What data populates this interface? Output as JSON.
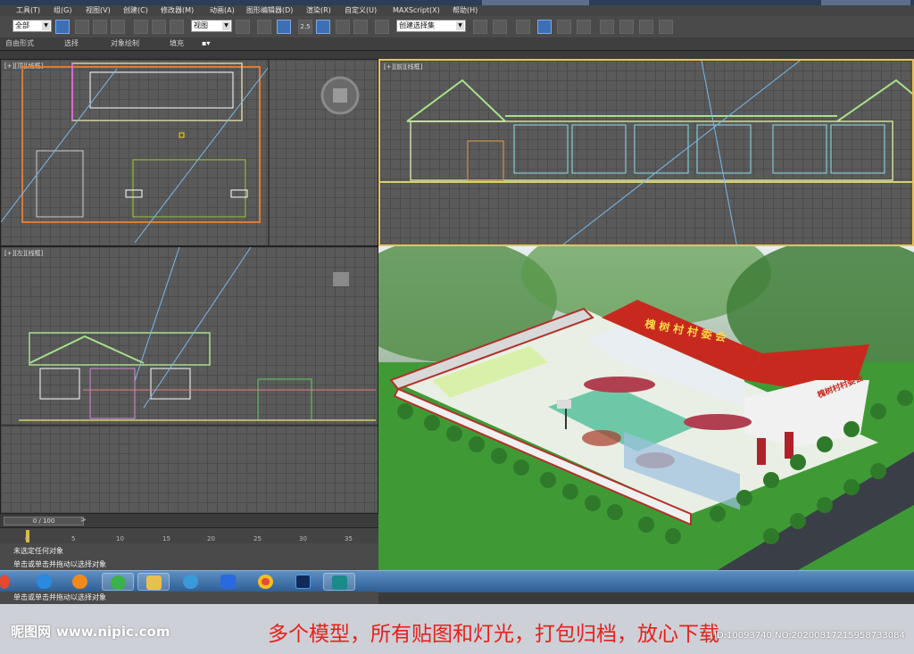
{
  "menu": {
    "items": [
      "工具(T)",
      "组(G)",
      "视图(V)",
      "创建(C)",
      "修改器(M)",
      "动画(A)",
      "图形编辑器(D)",
      "渲染(R)",
      "自定义(U)",
      "MAXScript(X)",
      "帮助(H)"
    ]
  },
  "toolbar": {
    "filter_value": "全部",
    "coord_value": "视图",
    "angle_snap": "2.5",
    "selection_set_placeholder": "创建选择集"
  },
  "ribbon": {
    "tabs": [
      "自由形式",
      "选择",
      "对象绘制",
      "填充"
    ]
  },
  "viewports": {
    "top_label": "[+][顶][线框]",
    "front_label": "[+][前][线框]",
    "left_label": "[+][左][线框]",
    "perspective_sign_text": "槐树村村委会",
    "gate_sign_text": "槐树村村委会"
  },
  "timeline": {
    "slider_text": "0 / 100",
    "ticks": [
      "0",
      "5",
      "10",
      "15",
      "20",
      "25",
      "30",
      "35"
    ]
  },
  "status": {
    "line1": "未选定任何对象",
    "line2": "单击或单击并拖动以选择对象",
    "line3": "单击或单击并拖动以选择对象"
  },
  "taskbar": {
    "apps": [
      "ie-icon",
      "media-player-icon",
      "ie-icon",
      "folder-icon",
      "browser-icon",
      "wps-icon",
      "chrome-icon",
      "photoshop-icon",
      "3dsmax-icon"
    ]
  },
  "watermark": {
    "site_logo": "昵图网",
    "site_url": "www.nipic.com",
    "caption": "多个模型，所有贴图和灯光，打包归档，放心下载",
    "id_text": "ID:10093740 NO:20200817215958733084"
  },
  "colors": {
    "accent_blue": "#3d6fb6",
    "taskbar": "#2d5d93",
    "caption_red": "#e8201c",
    "roof_red": "#c8291e",
    "grass": "#3f9a36"
  }
}
